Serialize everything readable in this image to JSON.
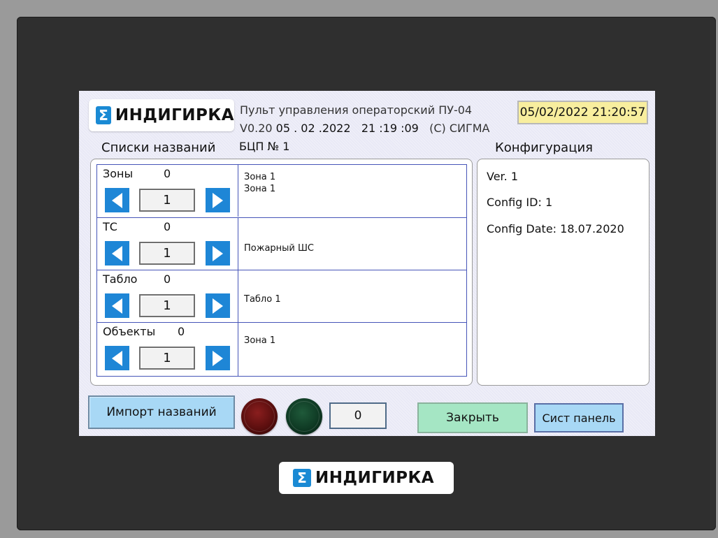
{
  "header": {
    "brand": "ИНДИГИРКА",
    "sigma": "Σ",
    "title": "Пульт управления операторский ПУ-04",
    "version_prefix": "V0.20",
    "build_date": "05 . 02 .2022",
    "build_time": "21 :19 :09",
    "copyright": "(C) СИГМА",
    "datetime": "05/02/2022 21:20:57"
  },
  "labels": {
    "lists": "Списки названий",
    "device": "БЦП № 1",
    "configuration": "Конфигурация"
  },
  "lists": [
    {
      "name": "Зоны",
      "count": "0",
      "index": "1",
      "values": [
        "Зона 1",
        "Зона 1"
      ]
    },
    {
      "name": "ТС",
      "count": "0",
      "index": "1",
      "values": [
        "Пожарный ШС"
      ]
    },
    {
      "name": "Табло",
      "count": "0",
      "index": "1",
      "values": [
        "Табло 1"
      ]
    },
    {
      "name": "Объекты",
      "count": "0",
      "index": "1",
      "values": [
        "Зона 1"
      ]
    }
  ],
  "config": {
    "ver": "Ver. 1",
    "config_id": "Config ID: 1",
    "config_date": "Config Date: 18.07.2020"
  },
  "footer": {
    "import_label": "Импорт названий",
    "counter": "0",
    "close_label": "Закрыть",
    "system_panel_label": "Сист панель"
  },
  "colors": {
    "arrow": "#1e86d6",
    "datetime_bg": "#f8ee9e",
    "close_bg": "#a5e6c4",
    "import_bg": "#a8d8f5",
    "border": "#4655b8"
  },
  "icons": {
    "arrow_left": "left-arrow-icon",
    "arrow_right": "right-arrow-icon",
    "red_lamp": "red-indicator-icon",
    "green_lamp": "green-indicator-icon"
  }
}
